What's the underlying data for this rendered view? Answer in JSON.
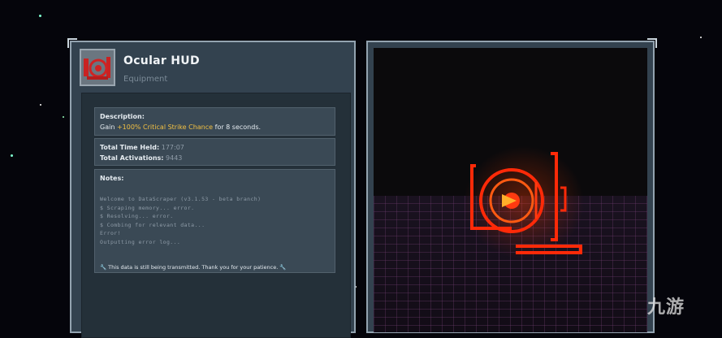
{
  "item": {
    "name": "Ocular HUD",
    "type": "Equipment",
    "icon": "ocular-hud-icon"
  },
  "description": {
    "heading": "Description:",
    "text_prefix": "Gain ",
    "highlight": "+100% Critical Strike Chance",
    "text_suffix": " for 8 seconds."
  },
  "stats": {
    "time_label": "Total Time Held:",
    "time_value": "177:07",
    "activations_label": "Total Activations:",
    "activations_value": "9443"
  },
  "notes": {
    "heading": "Notes:",
    "lines": [
      "Welcome to DataScraper (v3.1.53 - beta branch)",
      "$ Scraping memory... error.",
      "$ Resolving... error.",
      "$ Combing for relevant data...",
      "Error!",
      "Outputting error log..."
    ],
    "footer": "This data is still being transmitted. Thank you for your patience."
  },
  "watermark": "九游",
  "colors": {
    "highlight": "#f2c043",
    "model_glow": "#ff3b10"
  }
}
